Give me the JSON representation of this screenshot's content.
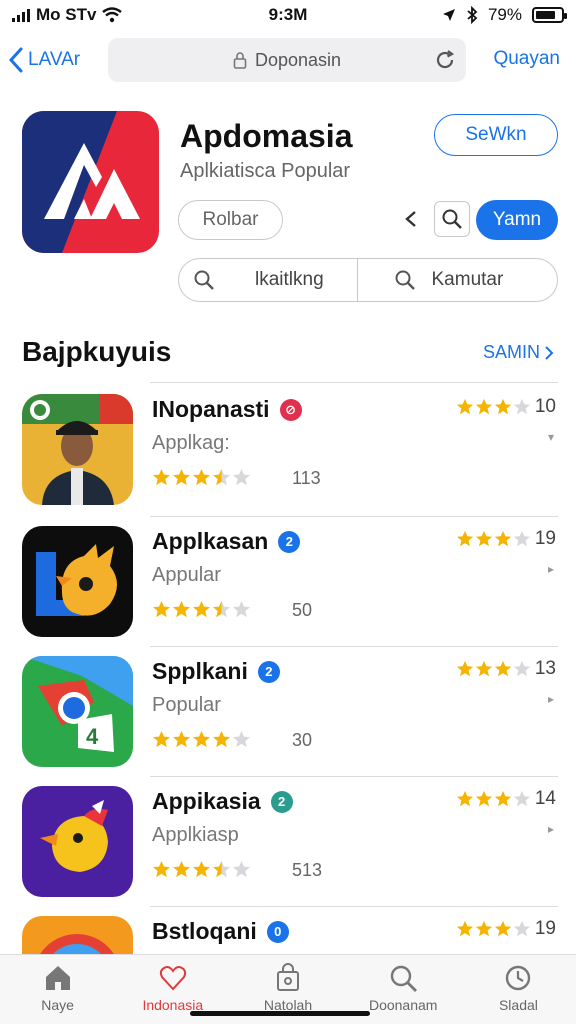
{
  "status": {
    "carrier": "Mo STv",
    "time": "9:3M",
    "battery": "79%",
    "battery_level": 0.79
  },
  "nav": {
    "back_label": "LAVAr",
    "url": "Doponasin",
    "right_label": "Quayan"
  },
  "app": {
    "title": "Apdomasia",
    "subtitle": "Aplkiatisca Popular",
    "top_button": "SeWkn",
    "gray_button": "Rolbar",
    "action_button": "Yamn",
    "seg_left": "lkaitlkng",
    "seg_right": "Kamutar"
  },
  "section": {
    "title": "Bajpkuyuis",
    "link": "SAMIN"
  },
  "apps": [
    {
      "name": "INopanasti",
      "badge_color": "#e0304e",
      "badge_glyph": "⊘",
      "sub": "Applkag:",
      "rating": 3.5,
      "count": "113",
      "rnum": "10"
    },
    {
      "name": "Applkasan",
      "badge_color": "#1a73e8",
      "badge_glyph": "2",
      "sub": "Appular",
      "rating": 3.5,
      "count": "50",
      "rnum": "19"
    },
    {
      "name": "Spplkani",
      "badge_color": "#1a73e8",
      "badge_glyph": "2",
      "sub": "Popular",
      "rating": 4,
      "count": "30",
      "rnum": "13"
    },
    {
      "name": "Appikasia",
      "badge_color": "#2a9d8f",
      "badge_glyph": "2",
      "sub": "Applkiasp",
      "rating": 3.5,
      "count": "513",
      "rnum": "14"
    },
    {
      "name": "Bstloqani",
      "badge_color": "#1a73e8",
      "badge_glyph": "0",
      "sub": "",
      "rating": 0,
      "count": "",
      "rnum": "19"
    }
  ],
  "tabs": [
    {
      "label": "Naye",
      "icon": "home-icon"
    },
    {
      "label": "Indonasia",
      "icon": "heart-icon"
    },
    {
      "label": "Natolah",
      "icon": "bag-icon"
    },
    {
      "label": "Doonanam",
      "icon": "search-icon"
    },
    {
      "label": "Sladal",
      "icon": "clock-icon"
    }
  ],
  "colors": {
    "accent": "#1a73e8",
    "star": "#f5b400",
    "active_tab": "#e03a3a"
  }
}
